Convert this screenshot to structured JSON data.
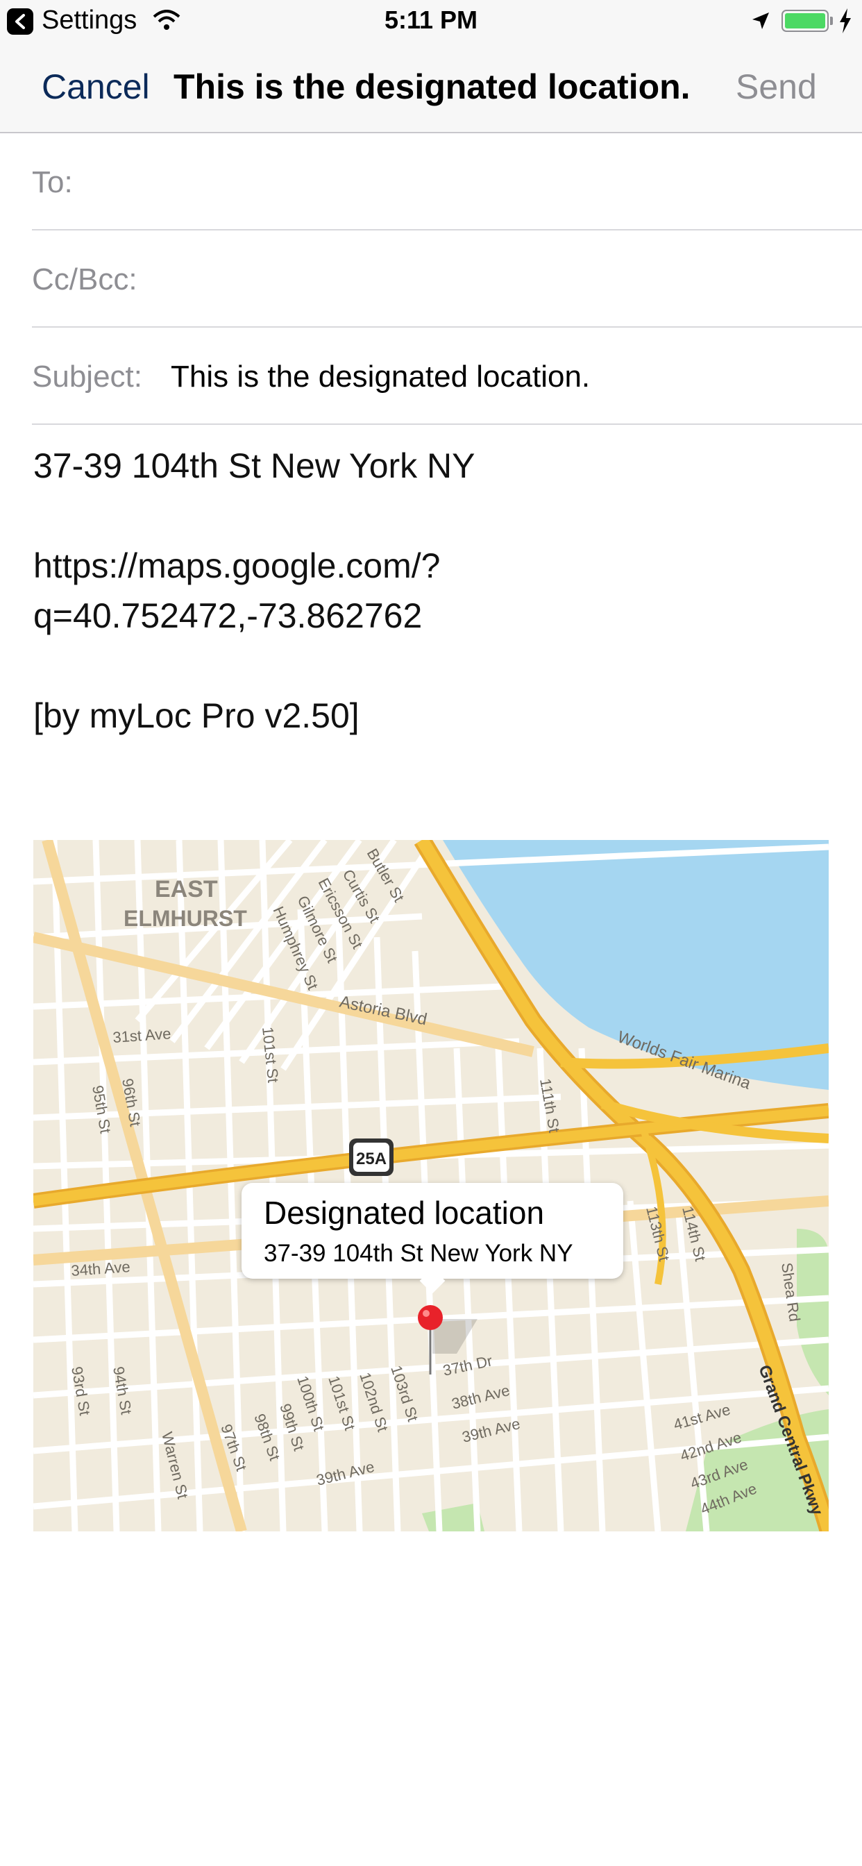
{
  "status_bar": {
    "back_label": "Settings",
    "time": "5:11 PM",
    "icons": [
      "back-arrow-icon",
      "wifi-icon",
      "location-arrow-icon",
      "battery-icon",
      "charging-bolt-icon"
    ],
    "battery_level": 1.0,
    "battery_color": "#4cd964"
  },
  "nav": {
    "cancel_label": "Cancel",
    "title": "This is the designated location.",
    "send_label": "Send",
    "cancel_color": "#0b2a59",
    "send_color": "#8e8e93"
  },
  "fields": {
    "to_label": "To:",
    "to_value": "",
    "cc_label": "Cc/Bcc:",
    "cc_value": "",
    "subject_label": "Subject:",
    "subject_value": "This is the designated location."
  },
  "body": {
    "address": "37-39 104th St New York NY",
    "link_line1": "https://maps.google.com/?",
    "link_line2": "q=40.752472,-73.862762",
    "signature": "[by myLoc Pro v2.50]"
  },
  "map": {
    "callout_title": "Designated location",
    "callout_subtitle": "37-39 104th St New York NY",
    "neighborhood_line1": "East",
    "neighborhood_line2": "Elmhurst",
    "route_shield": "25A",
    "water_label": "Worlds Fair Marina",
    "highway_label": "Grand Central Pkwy",
    "street_labels": {
      "astoria": "Astoria Blvd",
      "ave31": "31st Ave",
      "ave34": "34th Ave",
      "dr37": "37th Dr",
      "ave38": "38th Ave",
      "ave39a": "39th Ave",
      "ave39b": "39th Ave",
      "ave41": "41st Ave",
      "ave42": "42nd Ave",
      "ave43": "43rd Ave",
      "ave44": "44th Ave",
      "st93": "93rd St",
      "st94": "94th St",
      "st95": "95th St",
      "st96": "96th St",
      "st97": "97th St",
      "st98": "98th St",
      "st99": "99th St",
      "st100": "100th St",
      "st101": "101st St",
      "st101b": "101st St",
      "st102": "102nd St",
      "st103": "103rd St",
      "st111": "111th St",
      "st113": "113th St",
      "st114": "114th St",
      "butler": "Butler St",
      "curtis": "Curtis St",
      "ericsson": "Ericsson St",
      "gilmore": "Gilmore St",
      "humphrey": "Humphrey St",
      "warren": "Warren St",
      "shea": "Shea Rd"
    },
    "colors": {
      "land": "#f1ebdd",
      "water": "#a5d6f1",
      "park": "#c5e6b0",
      "highway": "#f5c33b",
      "street": "#ffffff",
      "pin": "#e8222a"
    }
  }
}
